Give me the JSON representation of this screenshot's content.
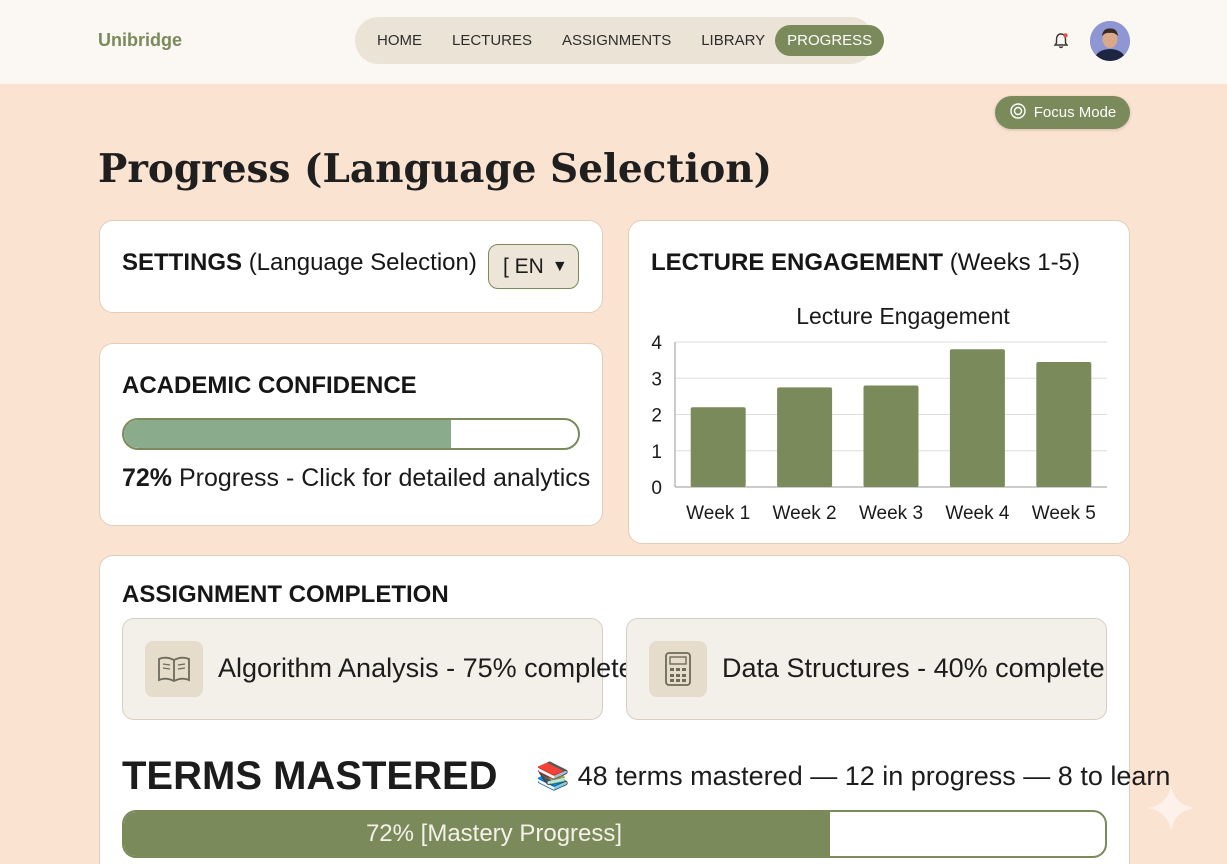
{
  "app": {
    "brand": "Unibridge"
  },
  "nav": {
    "items": [
      "HOME",
      "LECTURES",
      "ASSIGNMENTS",
      "LIBRARY",
      "PROGRESS"
    ],
    "active": "PROGRESS"
  },
  "header": {
    "notification_icon": "bell-icon",
    "avatar": "user-avatar"
  },
  "focus_mode": {
    "label": "Focus Mode",
    "icon": "focus-icon"
  },
  "page": {
    "title": "Progress (Language Selection)"
  },
  "settings": {
    "heading_bold": "SETTINGS",
    "heading_rest": "(Language Selection)",
    "language_value": "[ EN",
    "dropdown_icon": "caret-down-icon"
  },
  "confidence": {
    "heading": "ACADEMIC CONFIDENCE",
    "progress": 0.72,
    "percent_label": "72%",
    "text": "Progress - Click for detailed analytics"
  },
  "engagement": {
    "heading_bold": "LECTURE ENGAGEMENT",
    "heading_rest": "(Weeks 1-5)"
  },
  "chart_data": {
    "type": "bar",
    "title": "Lecture Engagement",
    "categories": [
      "Week 1",
      "Week 2",
      "Week 3",
      "Week 4",
      "Week 5"
    ],
    "values": [
      2.2,
      2.75,
      2.8,
      3.8,
      3.45
    ],
    "ylim": [
      0,
      4
    ],
    "yticks": [
      "0",
      "1",
      "2",
      "3",
      "4"
    ],
    "grid": true,
    "bar_color": "#7a8a5a"
  },
  "assignments": {
    "heading": "ASSIGNMENT COMPLETION",
    "items": [
      {
        "icon": "book-icon",
        "text": "Algorithm Analysis - 75% complete"
      },
      {
        "icon": "calculator-icon",
        "text": "Data Structures - 40% complete"
      }
    ]
  },
  "terms": {
    "heading": "TERMS MASTERED",
    "emoji": "📚",
    "summary": "48 terms mastered — 12 in progress — 8 to learn",
    "progress": 0.72,
    "bar_label": "72% [Mastery Progress]"
  },
  "colors": {
    "accent": "#7a8a5a",
    "background": "#fbe3d2",
    "confidence_fill": "#8aab8c"
  }
}
